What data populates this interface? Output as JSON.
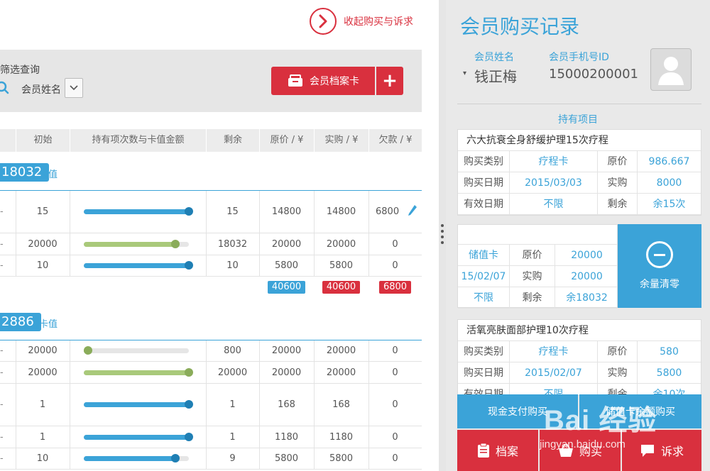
{
  "left": {
    "collapse_label": "收起购买与诉求",
    "filter": {
      "title": "筛选查询",
      "select_value": "会员姓名"
    },
    "buttons": {
      "member_card": "会员档案卡",
      "add": "+"
    },
    "columns": [
      "",
      "初始",
      "持有项次数与卡值金额",
      "剩余",
      "原价 / ¥",
      "实购 / ¥",
      "欠款 / ¥"
    ],
    "group1": {
      "badge": "18032",
      "type": "卡值",
      "rows": [
        {
          "dash": "-",
          "initial": "15",
          "fill": 1.0,
          "color": "blue",
          "remain": "15",
          "orig": "14800",
          "paid": "14800",
          "owe": "6800",
          "edit": true
        },
        {
          "dash": "-",
          "initial": "20000",
          "fill": 0.87,
          "color": "green",
          "remain": "18032",
          "orig": "20000",
          "paid": "20000",
          "owe": "0"
        },
        {
          "dash": "-",
          "initial": "10",
          "fill": 1.0,
          "color": "blue",
          "remain": "10",
          "orig": "5800",
          "paid": "5800",
          "owe": "0"
        }
      ],
      "totals": {
        "orig": "40600",
        "paid": "40600",
        "owe": "6800"
      }
    },
    "group2": {
      "badge": "2886",
      "type": "卡值",
      "rows": [
        {
          "dash": "-",
          "initial": "20000",
          "fill": 0.04,
          "color": "green",
          "remain": "800",
          "orig": "20000",
          "paid": "20000",
          "owe": "0"
        },
        {
          "dash": "-",
          "initial": "20000",
          "fill": 1.0,
          "color": "green",
          "remain": "20000",
          "orig": "20000",
          "paid": "20000",
          "owe": "0"
        },
        {
          "dash": "-",
          "initial": "1",
          "fill": 1.0,
          "color": "blue",
          "remain": "1",
          "orig": "168",
          "paid": "168",
          "owe": "0"
        },
        {
          "dash": "-",
          "initial": "1",
          "fill": 1.0,
          "color": "blue",
          "remain": "1",
          "orig": "1180",
          "paid": "1180",
          "owe": "0"
        },
        {
          "dash": "-",
          "initial": "10",
          "fill": 0.87,
          "color": "blue",
          "remain": "9",
          "orig": "5800",
          "paid": "5800",
          "owe": "0"
        }
      ]
    }
  },
  "right": {
    "title": "会员购买记录",
    "member_name_label": "会员姓名",
    "member_name": "钱正梅",
    "member_phone_label": "会员手机号ID",
    "member_phone": "15000200001",
    "holdings_label": "持有项目",
    "item1": {
      "title": "六大抗衰全身舒缓护理15次疗程",
      "rows": [
        [
          "购买类别",
          "疗程卡",
          "原价",
          "986.667"
        ],
        [
          "购买日期",
          "2015/03/03",
          "实购",
          "8000"
        ],
        [
          "有效日期",
          "不限",
          "剩余",
          "余15次"
        ]
      ]
    },
    "item2": {
      "rows": [
        [
          "储值卡",
          "原价",
          "20000"
        ],
        [
          "15/02/07",
          "实购",
          "20000"
        ],
        [
          "不限",
          "剩余",
          "余18032"
        ]
      ],
      "clear_label": "余量清零"
    },
    "item3": {
      "title": "活氧亮肤面部护理10次疗程",
      "rows": [
        [
          "购买类别",
          "疗程卡",
          "原价",
          "580"
        ],
        [
          "购买日期",
          "2015/02/07",
          "实购",
          "5800"
        ],
        [
          "有效日期",
          "不限",
          "剩余",
          "余10次"
        ]
      ]
    },
    "actions": {
      "cash_pay": "现金支付购买",
      "card_pay": "储值卡余额购买",
      "archive": "档案",
      "buy": "购买",
      "appeal": "诉求"
    }
  },
  "watermark": {
    "logo": "Bai 经验",
    "url": "jingyan.baidu.com"
  },
  "colors": {
    "accent_blue": "#3ba3d8",
    "accent_red": "#d9303e",
    "bar_green": "#a9c97a"
  }
}
